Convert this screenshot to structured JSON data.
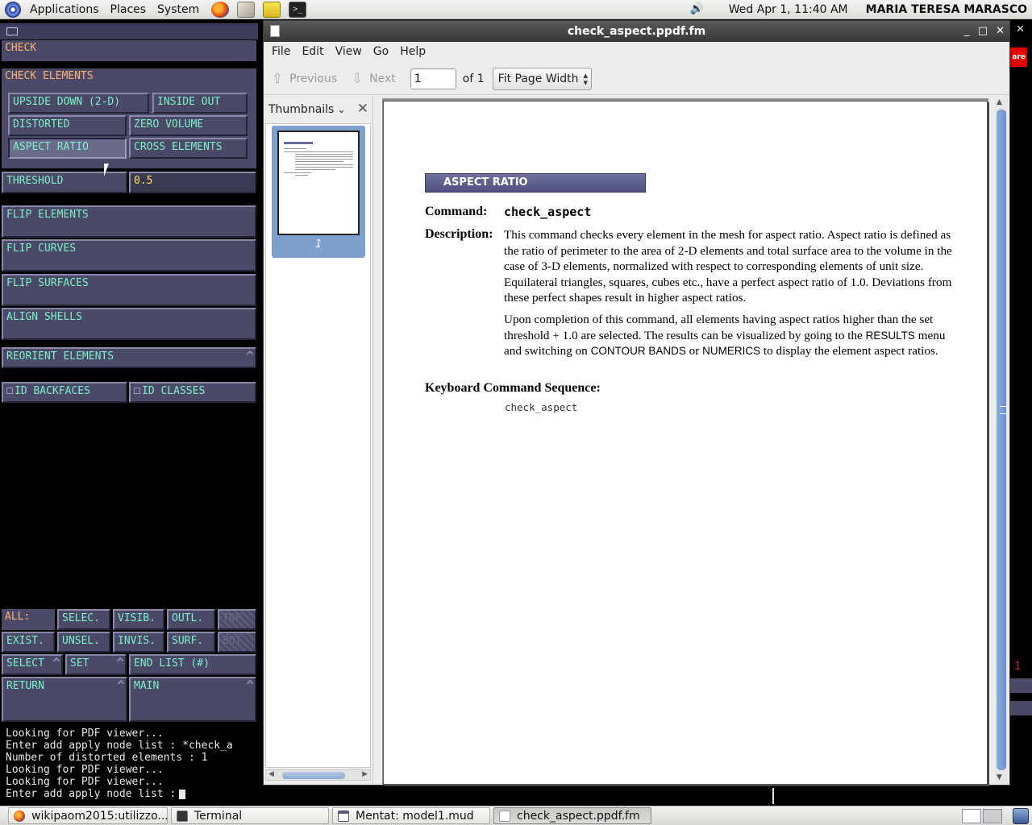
{
  "top_panel": {
    "menus": [
      "Applications",
      "Places",
      "System"
    ],
    "clock": "Wed Apr  1, 11:40 AM",
    "user": "MARIA TERESA MARASCO",
    "launchers": [
      "firefox-icon",
      "mail-icon",
      "notes-icon",
      "terminal-icon"
    ]
  },
  "mentat": {
    "check": "CHECK",
    "check_elements": "CHECK ELEMENTS",
    "upside_down": "UPSIDE DOWN (2-D)",
    "inside_out": "INSIDE OUT",
    "distorted": "DISTORTED",
    "zero_volume": "ZERO VOLUME",
    "aspect_ratio": "ASPECT RATIO",
    "cross_elements": "CROSS ELEMENTS",
    "threshold": "THRESHOLD",
    "threshold_value": "0.5",
    "flip_elements": "FLIP ELEMENTS",
    "flip_curves": "FLIP CURVES",
    "flip_surfaces": "FLIP SURFACES",
    "align_shells": "ALIGN SHELLS",
    "reorient_elements": "REORIENT ELEMENTS",
    "id_backfaces": "ID BACKFACES",
    "id_classes": "ID CLASSES",
    "all": "ALL:",
    "selec": "SELEC.",
    "visib": "VISIB.",
    "outl": "OUTL.",
    "top": "TOP",
    "exist": "EXIST.",
    "unsel": "UNSEL.",
    "invis": "INVIS.",
    "surf": "SURF.",
    "bot": "BOT",
    "select": "SELECT",
    "set": "SET",
    "end_list": "END LIST (#)",
    "return": "RETURN",
    "main": "MAIN"
  },
  "console": {
    "lines": [
      "Looking for PDF viewer...",
      "Enter add apply node list : *check_a",
      "Number of distorted elements : 1",
      "Looking for PDF viewer...",
      "Looking for PDF viewer...",
      "Enter add apply node list :"
    ]
  },
  "bg_window": {
    "close": "✕",
    "tag": "are",
    "number": "1"
  },
  "viewer": {
    "title": "check_aspect.ppdf.fm",
    "menu": [
      "File",
      "Edit",
      "View",
      "Go",
      "Help"
    ],
    "previous": "Previous",
    "next": "Next",
    "page_value": "1",
    "page_of": "of 1",
    "zoom": "Fit Page Width",
    "sidebar_title": "Thumbnails",
    "thumb_label": "1"
  },
  "document": {
    "heading": "ASPECT RATIO",
    "command_label": "Command:",
    "command": "check_aspect",
    "description_label": "Description:",
    "description_1": "This command checks every element in the mesh for aspect ratio. Aspect ratio is defined as the ratio of perimeter to the area of 2-D elements and total surface area to the volume in the case of 3-D elements, normalized with respect to corresponding elements of unit size. Equilateral triangles, squares, cubes etc., have a perfect aspect ratio of 1.0. Deviations from these perfect shapes result in higher aspect ratios.",
    "description_2a": "Upon completion of this command, all elements having aspect ratios higher than the set threshold + 1.0 are selected. The results can be visualized by going to the ",
    "results": "RESULTS",
    "description_2b": " menu and switching on ",
    "contour_bands": "CONTOUR BANDS",
    "description_2c": " or ",
    "numerics": "NUMERICS",
    "description_2d": " to display the element aspect ratios.",
    "keyboard_label": "Keyboard Command Sequence:",
    "keyboard_sequence": "check_aspect"
  },
  "taskbar": {
    "tasks": [
      "wikipaom2015:utilizzo...",
      "Terminal",
      "Mentat: model1.mud",
      "check_aspect.ppdf.fm"
    ]
  }
}
